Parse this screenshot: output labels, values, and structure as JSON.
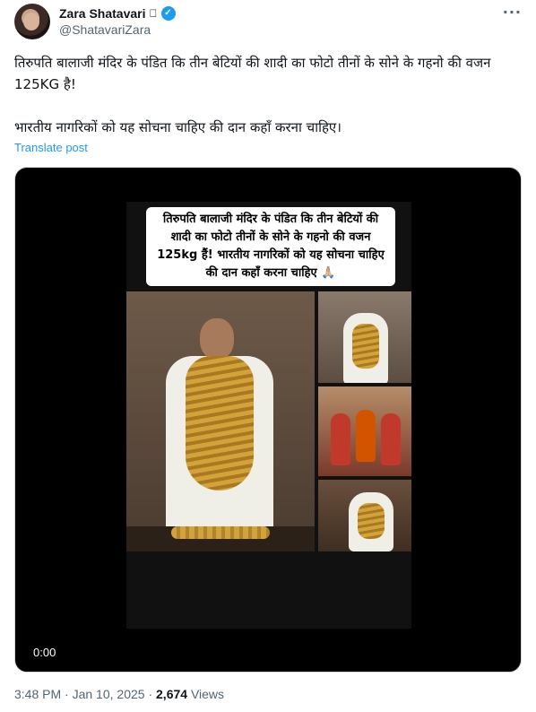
{
  "author": {
    "display_name": "Zara Shatavari",
    "handle": "@ShatavariZara",
    "badge_icon": "apple-icon",
    "verified_icon": "verified-badge-icon",
    "verified_color": "#1d9bf0"
  },
  "menu": {
    "more_icon": "more-icon"
  },
  "tweet": {
    "line1": "तिरुपति बालाजी मंदिर के पंडित कि तीन बेटियों की शादी का फोटो तीनों के सोने के गहनो की वजन 125KG है!",
    "line2": "भारतीय नागरिकों को यह सोचना चाहिए की दान कहाँ करना चाहिए।",
    "translate_label": "Translate post"
  },
  "media": {
    "caption": "तिरुपति बालाजी मंदिर के पंडित कि तीन बेटियों की शादी का फोटो तीनों के सोने के गहनो की वजन 125kg हैं! भारतीय नागरिकों को यह सोचना चाहिए की दान कहाँ करना चाहिए 🙏🏼",
    "video_time": "0:00"
  },
  "meta": {
    "time": "3:48 PM",
    "sep1": " · ",
    "date": "Jan 10, 2025",
    "sep2": " · ",
    "views_count": "2,674",
    "views_label": " Views"
  }
}
